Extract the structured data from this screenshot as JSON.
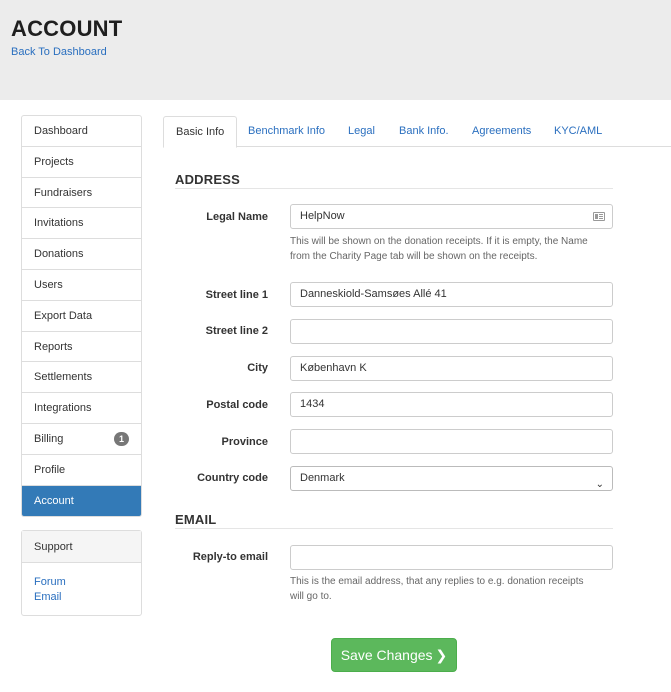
{
  "header": {
    "title": "ACCOUNT",
    "back_link": "Back To Dashboard"
  },
  "sidebar": {
    "items": [
      {
        "label": "Dashboard"
      },
      {
        "label": "Projects"
      },
      {
        "label": "Fundraisers"
      },
      {
        "label": "Invitations"
      },
      {
        "label": "Donations"
      },
      {
        "label": "Users"
      },
      {
        "label": "Export Data"
      },
      {
        "label": "Reports"
      },
      {
        "label": "Settlements"
      },
      {
        "label": "Integrations"
      },
      {
        "label": "Billing",
        "badge": "1"
      },
      {
        "label": "Profile"
      },
      {
        "label": "Account",
        "active": true
      }
    ]
  },
  "support": {
    "title": "Support",
    "links": [
      "Forum",
      "Email"
    ]
  },
  "tabs": [
    {
      "label": "Basic Info",
      "active": true
    },
    {
      "label": "Benchmark Info"
    },
    {
      "label": "Legal"
    },
    {
      "label": "Bank Info."
    },
    {
      "label": "Agreements"
    },
    {
      "label": "KYC/AML"
    }
  ],
  "address": {
    "title": "ADDRESS",
    "legal_name": {
      "label": "Legal Name",
      "value": "HelpNow",
      "icon": "id-card-icon"
    },
    "legal_name_help_1": "This will be shown on the donation receipts. If it is empty, the Name",
    "legal_name_help_2": "from the Charity Page tab will be shown on the receipts.",
    "street1": {
      "label": "Street line 1",
      "value": "Danneskiold-Samsøes Allé 41"
    },
    "street2": {
      "label": "Street line 2",
      "value": ""
    },
    "city": {
      "label": "City",
      "value": "København K"
    },
    "postal": {
      "label": "Postal code",
      "value": "1434"
    },
    "province": {
      "label": "Province",
      "value": ""
    },
    "country": {
      "label": "Country code",
      "value": "Denmark"
    }
  },
  "email": {
    "title": "EMAIL",
    "reply_to": {
      "label": "Reply-to email",
      "value": ""
    },
    "help_1": "This is the email address, that any replies to e.g. donation receipts",
    "help_2": "will go to."
  },
  "actions": {
    "save_label": "Save Changes",
    "save_chevron": "❯"
  },
  "colors": {
    "accent": "#337ab7",
    "link": "#2a6fbf",
    "success": "#5cb85c",
    "header_bg": "#ececec"
  }
}
